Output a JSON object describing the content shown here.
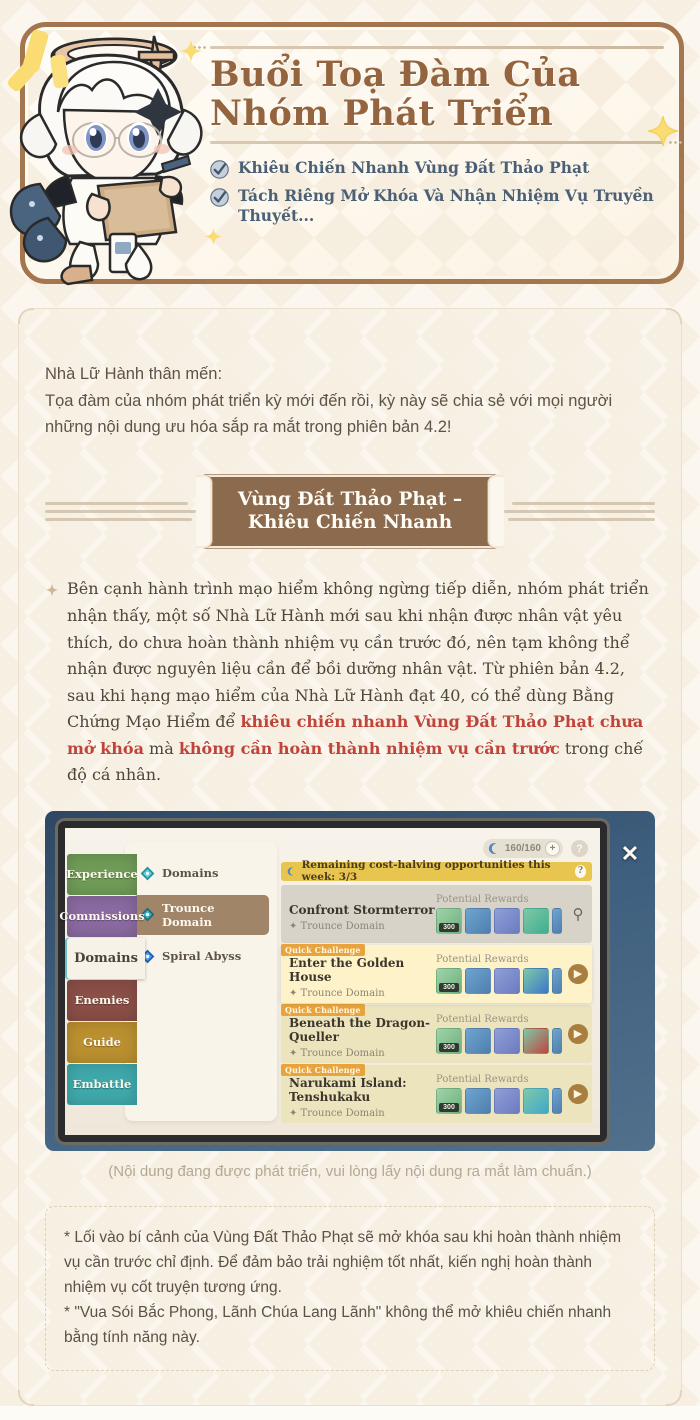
{
  "header": {
    "title_line1": "Buổi Toạ Đàm Của",
    "title_line2": "Nhóm Phát Triển",
    "bullets": [
      "Khiêu Chiến Nhanh Vùng Đất Thảo Phạt",
      "Tách Riêng Mở Khóa Và Nhận Nhiệm Vụ Truyền Thuyết..."
    ],
    "character_name": "paimon-illustration"
  },
  "body": {
    "greeting_line1": "Nhà Lữ Hành thân mến:",
    "greeting_line2": "Tọa đàm của nhóm phát triển kỳ mới đến rồi, kỳ này sẽ chia sẻ với mọi người những nội dung ưu hóa sắp ra mắt trong phiên bản 4.2!",
    "section_title_line1": "Vùng Đất Thảo Phạt –",
    "section_title_line2": "Khiêu Chiến Nhanh",
    "paragraph": {
      "part1": "Bên cạnh hành trình mạo hiểm không ngừng tiếp diễn, nhóm phát triển nhận thấy, một số Nhà Lữ Hành mới sau khi nhận được nhân vật yêu thích, do chưa hoàn thành nhiệm vụ cần trước đó, nên tạm không thể nhận được nguyên liệu cần để bồi dưỡng nhân vật. Từ phiên bản 4.2, sau khi hạng mạo hiểm của Nhà Lữ Hành đạt 40, có thể dùng Bằng Chứng Mạo Hiểm để ",
      "highlight1": "khiêu chiến nhanh Vùng Đất Thảo Phạt chưa mở khóa",
      "part2": " mà ",
      "highlight2": "không cần hoàn thành nhiệm vụ cần trước",
      "part3": " trong chế độ cá nhân."
    },
    "screenshot_caption": "(Nội dung đang được phát triển, vui lòng lấy nội dung ra mắt làm chuẩn.)",
    "footnote_line1": "* Lối vào bí cảnh của Vùng Đất Thảo Phạt sẽ mở khóa sau khi hoàn thành nhiệm vụ cần trước chỉ định. Để đảm bảo trải nghiệm tốt nhất, kiến nghị hoàn thành nhiệm vụ cốt truyện tương ứng.",
    "footnote_line2": "* \"Vua Sói Bắc Phong, Lãnh Chúa Lang Lãnh\" không thể mở khiêu chiến nhanh bằng tính năng này."
  },
  "game_ui": {
    "tabs": [
      {
        "label": "Experience",
        "color": "#6f9b57",
        "active": false
      },
      {
        "label": "Commissions",
        "color": "#8a6aa0",
        "active": false
      },
      {
        "label": "Domains",
        "color": "#f7f2e7",
        "active": true
      },
      {
        "label": "Enemies",
        "color": "#8a4f47",
        "active": false
      },
      {
        "label": "Guide",
        "color": "#bb9030",
        "active": false
      },
      {
        "label": "Embattle",
        "color": "#3fa8ab",
        "active": false
      }
    ],
    "domain_categories": [
      {
        "label": "Domains",
        "selected": false
      },
      {
        "label": "Trounce Domain",
        "selected": true
      },
      {
        "label": "Spiral Abyss",
        "selected": false
      }
    ],
    "resin_value": "160/160",
    "week_bar_text": "Remaining cost-halving opportunities this week: 3/3",
    "potential_rewards_label": "Potential Rewards",
    "quick_challenge_tag": "Quick Challenge",
    "reward_count_badge": "300",
    "quests": [
      {
        "title": "Confront Stormterror",
        "subtitle": "Trounce Domain",
        "state": "locked",
        "tagged": false
      },
      {
        "title": "Enter the Golden House",
        "subtitle": "Trounce Domain",
        "state": "active",
        "tagged": true
      },
      {
        "title": "Beneath the Dragon-Queller",
        "subtitle": "Trounce Domain",
        "state": "avail",
        "tagged": true
      },
      {
        "title": "Narukami Island: Tenshukaku",
        "subtitle": "Trounce Domain",
        "state": "avail",
        "tagged": true
      }
    ]
  },
  "colors": {
    "title_brown": "#93643e",
    "banner_brown": "#8c6a4d",
    "highlight_red": "#c0443a",
    "bullet_blue": "#4c6075",
    "accent_yellow": "#fcdd6d"
  }
}
